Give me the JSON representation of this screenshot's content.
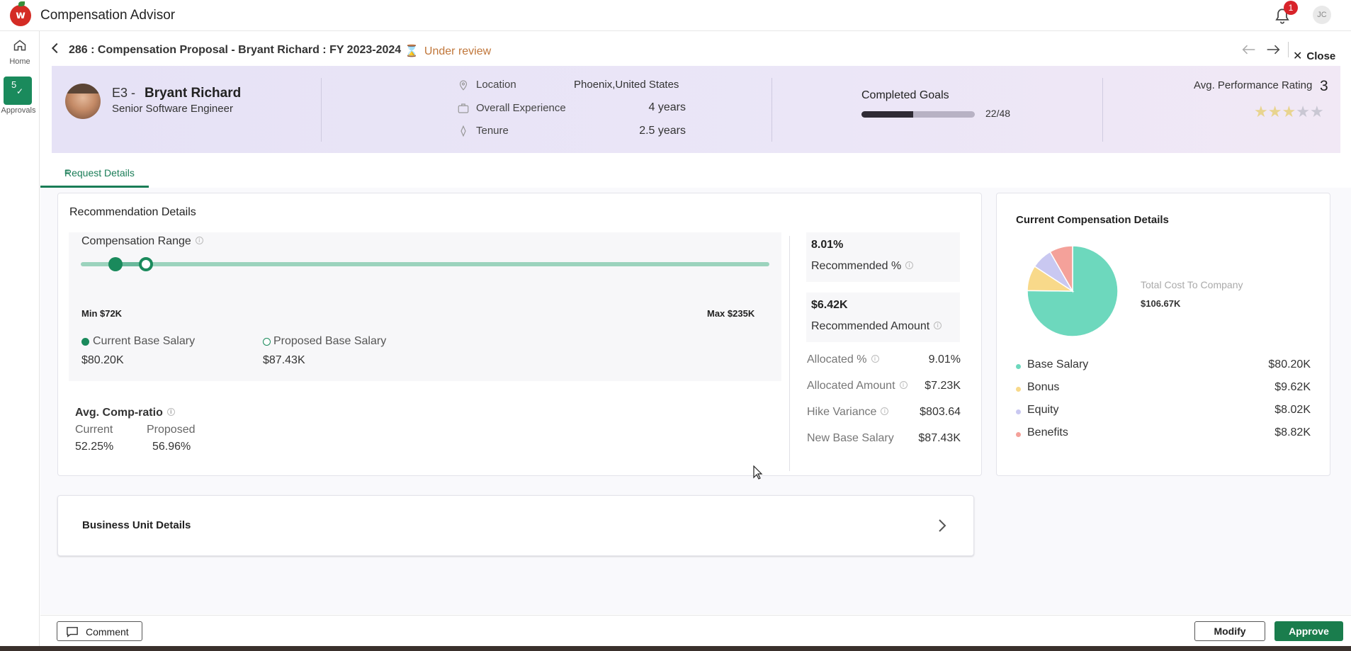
{
  "app": {
    "title": "Compensation Advisor",
    "logo_letter": "w",
    "notification_count": "1",
    "user_initials": "JC"
  },
  "rail": {
    "home_label": "Home",
    "approvals_count": "5",
    "approvals_label": "Approvals"
  },
  "titlebar": {
    "title": "286 : Compensation Proposal - Bryant Richard : FY 2023-2024",
    "status": "Under review",
    "close_label": "Close"
  },
  "employee": {
    "grade": "E3 -",
    "name": "Bryant Richard",
    "role": "Senior Software Engineer",
    "location_label": "Location",
    "location_value": "Phoenix,United States",
    "experience_label": "Overall Experience",
    "experience_value": "4 years",
    "tenure_label": "Tenure",
    "tenure_value": "2.5 years",
    "goals_label": "Completed Goals",
    "goals_value": "22/48",
    "goals_completed": 22,
    "goals_total": 48,
    "perf_label": "Avg. Performance Rating",
    "perf_value": "3",
    "perf_stars": 3,
    "perf_max": 5
  },
  "tabs": {
    "request_details": "Request Details"
  },
  "recommendation": {
    "title": "Recommendation Details",
    "range_title": "Compensation Range",
    "min_label": "Min $72K",
    "max_label": "Max $235K",
    "min_value": 72000,
    "max_value": 235000,
    "current_value": 80200,
    "proposed_value": 87430,
    "current_label": "Current Base Salary",
    "current_amount": "$80.20K",
    "proposed_label": "Proposed Base Salary",
    "proposed_amount": "$87.43K",
    "comp_ratio_title": "Avg. Comp-ratio",
    "comp_ratio_current_label": "Current",
    "comp_ratio_current_value": "52.25%",
    "comp_ratio_proposed_label": "Proposed",
    "comp_ratio_proposed_value": "56.96%",
    "recommended_pct_value": "8.01%",
    "recommended_pct_label": "Recommended %",
    "recommended_amount_value": "$6.42K",
    "recommended_amount_label": "Recommended Amount",
    "allocated_pct_label": "Allocated %",
    "allocated_pct_value": "9.01%",
    "allocated_amount_label": "Allocated Amount",
    "allocated_amount_value": "$7.23K",
    "hike_variance_label": "Hike Variance",
    "hike_variance_value": "$803.64",
    "new_base_label": "New Base Salary",
    "new_base_value": "$87.43K"
  },
  "current_comp": {
    "title": "Current Compensation Details",
    "total_label": "Total Cost To Company",
    "total_value": "$106.67K",
    "items": [
      {
        "label": "Base Salary",
        "value": "$80.20K",
        "amount": 80.2,
        "color": "#6dd8bd"
      },
      {
        "label": "Bonus",
        "value": "$9.62K",
        "amount": 9.62,
        "color": "#f8d98a"
      },
      {
        "label": "Equity",
        "value": "$8.02K",
        "amount": 8.02,
        "color": "#c9c8f1"
      },
      {
        "label": "Benefits",
        "value": "$8.82K",
        "amount": 8.82,
        "color": "#f4a19a"
      }
    ]
  },
  "business_unit": {
    "title": "Business Unit Details"
  },
  "footer": {
    "comment_label": "Comment",
    "modify_label": "Modify",
    "approve_label": "Approve"
  },
  "colors": {
    "primary": "#1a8a5c",
    "approve": "#1a7d4d",
    "status": "#c0763a",
    "badge": "#d8232a"
  }
}
